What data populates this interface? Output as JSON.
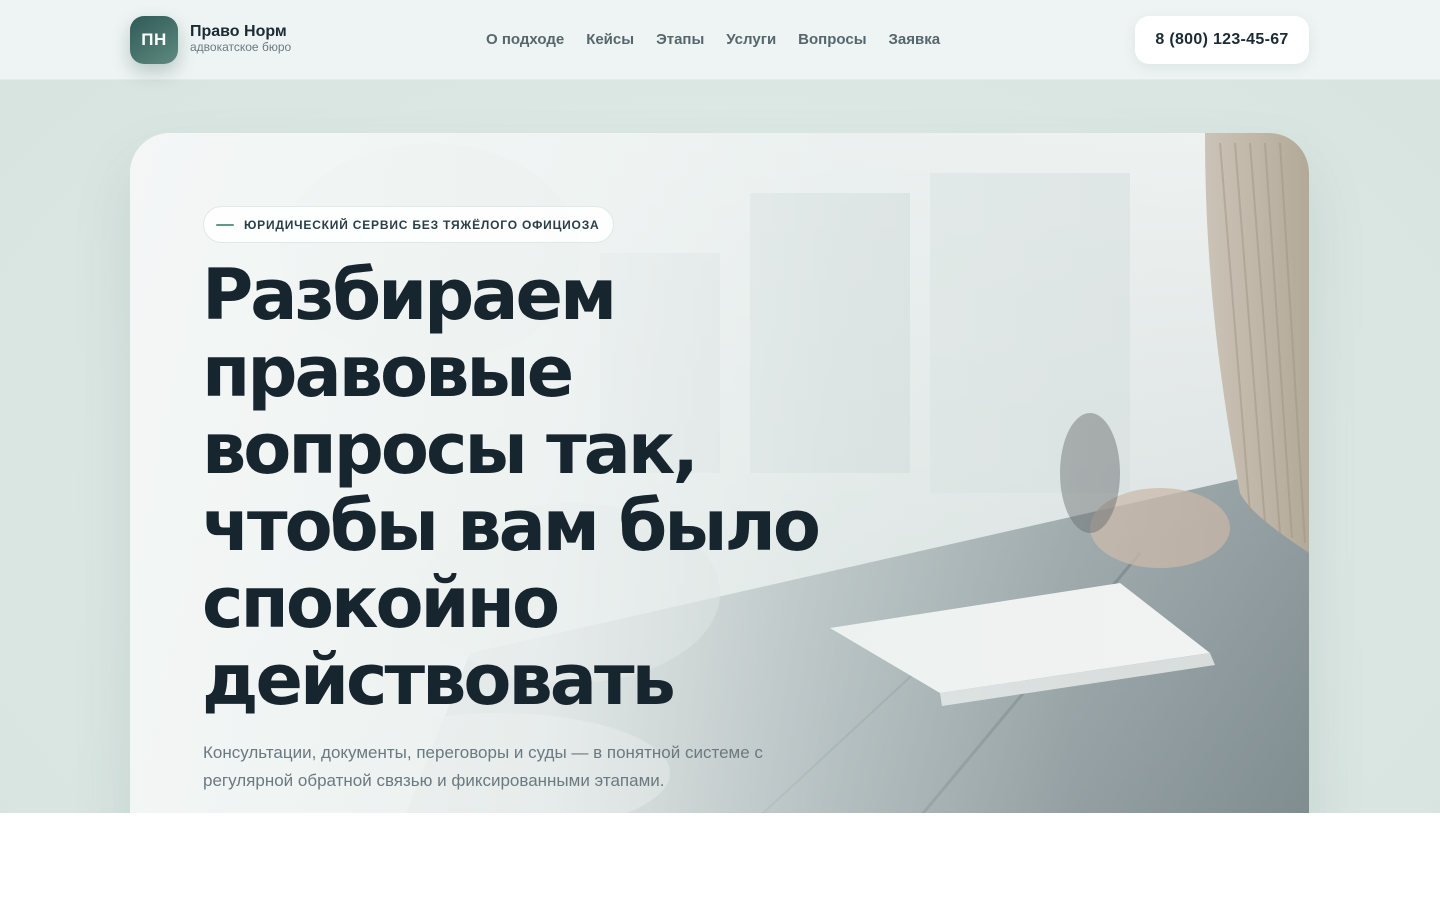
{
  "header": {
    "logo_initials": "ПН",
    "brand_name": "Право Норм",
    "brand_subtitle": "адвокатское бюро",
    "nav": [
      {
        "label": "О подходе"
      },
      {
        "label": "Кейсы"
      },
      {
        "label": "Этапы"
      },
      {
        "label": "Услуги"
      },
      {
        "label": "Вопросы"
      },
      {
        "label": "Заявка"
      }
    ],
    "phone": "8 (800) 123-45-67"
  },
  "hero": {
    "badge": "ЮРИДИЧЕСКИЙ СЕРВИС БЕЗ ТЯЖЁЛОГО ОФИЦИОЗА",
    "title_lines": [
      "Разбираем",
      "правовые",
      "вопросы так,",
      "чтобы вам было",
      "спокойно",
      "действовать"
    ],
    "lead": "Консультации, документы, переговоры и суды — в понятной системе с регулярной обратной связью и фиксированными этапами."
  },
  "colors": {
    "accent": "#2f5a57",
    "accent_light": "#5f9a86",
    "text_dark": "#17252e",
    "text_muted": "#6b7980",
    "page_bg": "#dbe7e3"
  }
}
